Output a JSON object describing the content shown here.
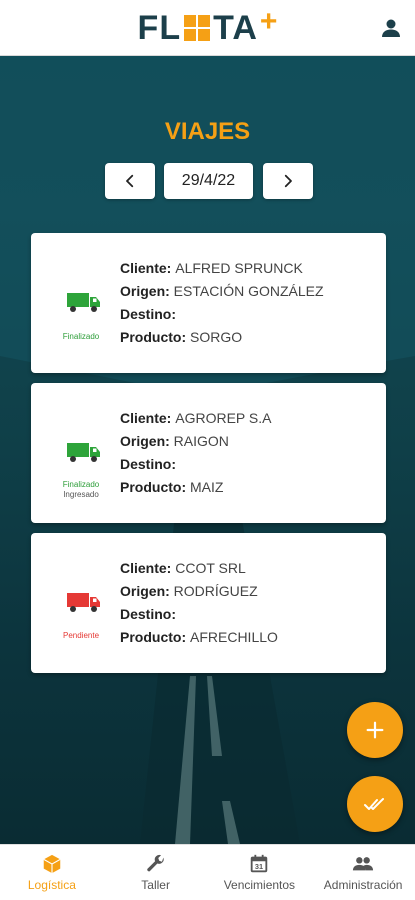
{
  "header": {
    "logo_left": "FL",
    "logo_right": "TA",
    "logo_plus": "+",
    "user_icon": "person-icon"
  },
  "page": {
    "title": "VIAJES",
    "date": "29/4/22",
    "prev_icon": "chevron-left-icon",
    "next_icon": "chevron-right-icon"
  },
  "trips": [
    {
      "status_lines": [
        "Finalizado"
      ],
      "status_color": "#2e9e3a",
      "truck_color": "#2ea43a",
      "cliente_label": "Cliente:",
      "cliente": "ALFRED SPRUNCK",
      "origen_label": "Origen:",
      "origen": "ESTACIÓN GONZÁLEZ",
      "destino_label": "Destino:",
      "destino": "",
      "producto_label": "Producto:",
      "producto": "SORGO"
    },
    {
      "status_lines": [
        "Finalizado",
        "Ingresado"
      ],
      "status_color": "#2e9e3a",
      "truck_color": "#2ea43a",
      "cliente_label": "Cliente:",
      "cliente": "AGROREP S.A",
      "origen_label": "Origen:",
      "origen": "RAIGON",
      "destino_label": "Destino:",
      "destino": "",
      "producto_label": "Producto:",
      "producto": "MAIZ"
    },
    {
      "status_lines": [
        "Pendiente"
      ],
      "status_color": "#e53935",
      "truck_color": "#e53935",
      "cliente_label": "Cliente:",
      "cliente": "CCOT SRL",
      "origen_label": "Origen:",
      "origen": "RODRÍGUEZ",
      "destino_label": "Destino:",
      "destino": "",
      "producto_label": "Producto:",
      "producto": "AFRECHILLO"
    }
  ],
  "fabs": {
    "add_icon": "plus-icon",
    "done_icon": "double-check-icon"
  },
  "bottom_nav": [
    {
      "label": "Logística",
      "icon": "cube-icon",
      "active": true
    },
    {
      "label": "Taller",
      "icon": "wrench-icon",
      "active": false
    },
    {
      "label": "Vencimientos",
      "icon": "calendar-icon",
      "active": false
    },
    {
      "label": "Administración",
      "icon": "people-icon",
      "active": false
    }
  ],
  "colors": {
    "accent": "#f5a015",
    "brand_dark": "#1c3f4a",
    "background": "#0e3a44"
  }
}
